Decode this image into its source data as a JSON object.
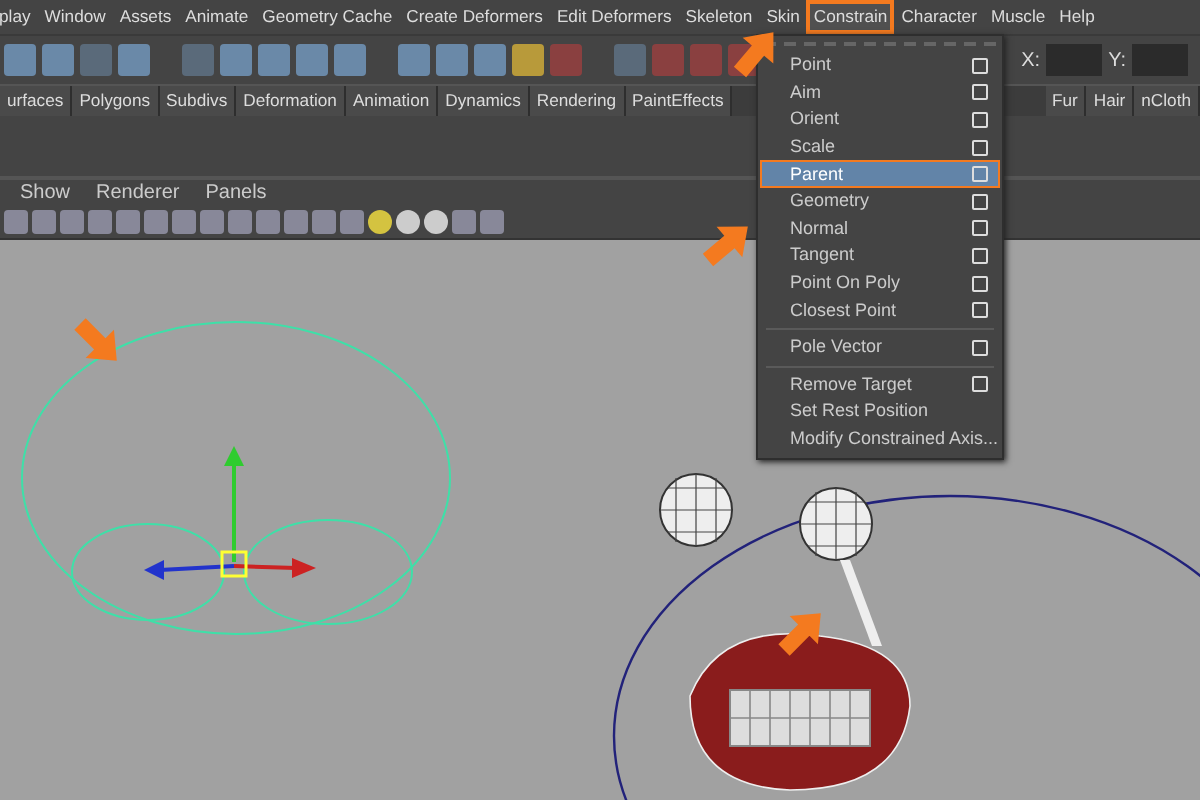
{
  "menu_bar": [
    {
      "label": "play",
      "selected": false
    },
    {
      "label": "Window",
      "selected": false
    },
    {
      "label": "Assets",
      "selected": false
    },
    {
      "label": "Animate",
      "selected": false
    },
    {
      "label": "Geometry Cache",
      "selected": false
    },
    {
      "label": "Create Deformers",
      "selected": false
    },
    {
      "label": "Edit Deformers",
      "selected": false
    },
    {
      "label": "Skeleton",
      "selected": false
    },
    {
      "label": "Skin",
      "selected": false
    },
    {
      "label": "Constrain",
      "selected": true
    },
    {
      "label": "Character",
      "selected": false
    },
    {
      "label": "Muscle",
      "selected": false
    },
    {
      "label": "Help",
      "selected": false
    }
  ],
  "toolbar": {
    "field_labels": [
      "X:",
      "Y:"
    ]
  },
  "shelf_tabs_left": [
    "urfaces",
    "Polygons",
    "Subdivs",
    "Deformation",
    "Animation",
    "Dynamics",
    "Rendering",
    "PaintEffects"
  ],
  "shelf_tabs_right": [
    "Fur",
    "Hair",
    "nCloth"
  ],
  "panel_menu": [
    "Show",
    "Renderer",
    "Panels"
  ],
  "dropdown": {
    "items": [
      {
        "kind": "item",
        "label": "Point",
        "option_box": true,
        "selected": false
      },
      {
        "kind": "item",
        "label": "Aim",
        "option_box": true,
        "selected": false
      },
      {
        "kind": "item",
        "label": "Orient",
        "option_box": true,
        "selected": false
      },
      {
        "kind": "item",
        "label": "Scale",
        "option_box": true,
        "selected": false
      },
      {
        "kind": "item",
        "label": "Parent",
        "option_box": true,
        "selected": true
      },
      {
        "kind": "item",
        "label": "Geometry",
        "option_box": true,
        "selected": false
      },
      {
        "kind": "item",
        "label": "Normal",
        "option_box": true,
        "selected": false
      },
      {
        "kind": "item",
        "label": "Tangent",
        "option_box": true,
        "selected": false
      },
      {
        "kind": "item",
        "label": "Point On Poly",
        "option_box": true,
        "selected": false
      },
      {
        "kind": "item",
        "label": "Closest Point",
        "option_box": true,
        "selected": false
      },
      {
        "kind": "separator"
      },
      {
        "kind": "item",
        "label": "Pole Vector",
        "option_box": true,
        "selected": false
      },
      {
        "kind": "separator"
      },
      {
        "kind": "item",
        "label": "Remove Target",
        "option_box": true,
        "selected": false
      },
      {
        "kind": "item",
        "label": "Set Rest Position",
        "option_box": false,
        "selected": false
      },
      {
        "kind": "item",
        "label": "Modify Constrained Axis...",
        "option_box": false,
        "selected": false
      }
    ]
  }
}
